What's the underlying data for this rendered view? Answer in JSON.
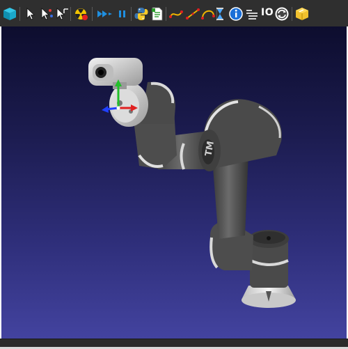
{
  "toolbar": {
    "io_label": "IO",
    "icons": [
      "cube-icon",
      "pointer-icon",
      "multi-pointer-icon",
      "pointer-axes-icon",
      "fire-icon",
      "play-icon",
      "pause-icon",
      "python-icon",
      "document-icon",
      "path-icon-1",
      "path-icon-2",
      "path-icon-3",
      "hourglass-icon",
      "info-icon",
      "list-icon",
      "refresh-icon",
      "package-icon"
    ]
  },
  "viewport": {
    "background_top": "#0d0d2e",
    "background_bottom": "#43439f",
    "robot_body_color": "#5a5a5a",
    "robot_cap_color": "#d8d8d8"
  }
}
